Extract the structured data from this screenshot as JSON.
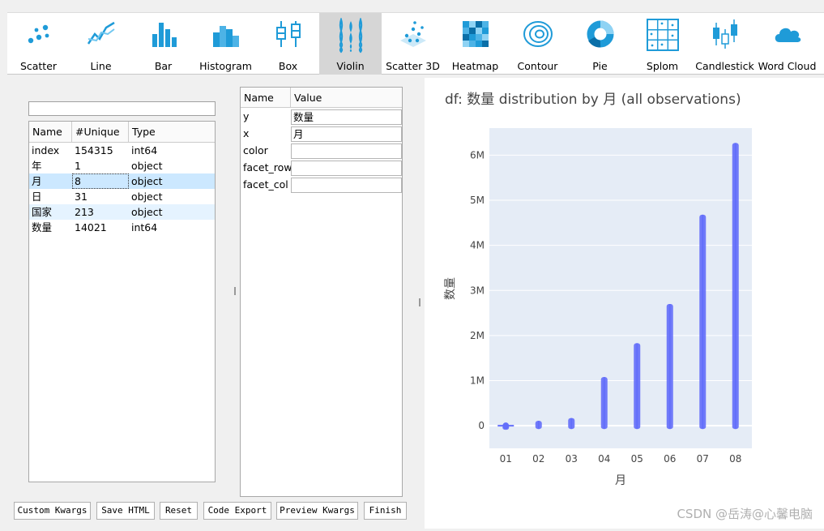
{
  "toolbar": {
    "items": [
      {
        "label": "Scatter",
        "icon": "scatter-icon"
      },
      {
        "label": "Line",
        "icon": "line-icon"
      },
      {
        "label": "Bar",
        "icon": "bar-icon"
      },
      {
        "label": "Histogram",
        "icon": "histogram-icon"
      },
      {
        "label": "Box",
        "icon": "box-icon"
      },
      {
        "label": "Violin",
        "icon": "violin-icon",
        "active": true
      },
      {
        "label": "Scatter 3D",
        "icon": "scatter3d-icon"
      },
      {
        "label": "Heatmap",
        "icon": "heatmap-icon"
      },
      {
        "label": "Contour",
        "icon": "contour-icon"
      },
      {
        "label": "Pie",
        "icon": "pie-icon"
      },
      {
        "label": "Splom",
        "icon": "splom-icon"
      },
      {
        "label": "Candlestick",
        "icon": "candlestick-icon"
      },
      {
        "label": "Word Cloud",
        "icon": "cloud-icon"
      }
    ]
  },
  "columns": {
    "filter_value": "",
    "headers": [
      "Name",
      "#Unique",
      "Type"
    ],
    "rows": [
      {
        "name": "index",
        "unique": "154315",
        "type": "int64"
      },
      {
        "name": "年",
        "unique": "1",
        "type": "object"
      },
      {
        "name": "月",
        "unique": "8",
        "type": "object",
        "selected": true
      },
      {
        "name": "日",
        "unique": "31",
        "type": "object"
      },
      {
        "name": "国家",
        "unique": "213",
        "type": "object",
        "hover": true
      },
      {
        "name": "数量",
        "unique": "14021",
        "type": "int64"
      }
    ]
  },
  "kwargs": {
    "headers": [
      "Name",
      "Value"
    ],
    "rows": [
      {
        "name": "y",
        "value": "数量"
      },
      {
        "name": "x",
        "value": "月"
      },
      {
        "name": "color",
        "value": ""
      },
      {
        "name": "facet_row",
        "value": ""
      },
      {
        "name": "facet_col",
        "value": ""
      }
    ]
  },
  "buttons": {
    "custom_kwargs": "Custom Kwargs",
    "save_html": "Save HTML",
    "reset": "Reset",
    "code_export": "Code Export",
    "preview_kwargs": "Preview Kwargs",
    "finish": "Finish"
  },
  "colors": {
    "accent": "#1f9bd8",
    "violin": "#636efa",
    "plot_bg": "#e5ecf6",
    "selection": "#cce8ff"
  },
  "chart_data": {
    "type": "violin",
    "title": "df: 数量 distribution by 月 (all observations)",
    "xlabel": "月",
    "ylabel": "数量",
    "categories": [
      "01",
      "02",
      "03",
      "04",
      "05",
      "06",
      "07",
      "08"
    ],
    "ylim": [
      -500000,
      6600000
    ],
    "yticks": [
      0,
      1000000,
      2000000,
      3000000,
      4000000,
      5000000,
      6000000
    ],
    "ytick_labels": [
      "0",
      "1M",
      "2M",
      "3M",
      "4M",
      "5M",
      "6M"
    ],
    "series": [
      {
        "points": "all",
        "values_min": [
          0,
          0,
          0,
          0,
          0,
          0,
          0,
          0
        ],
        "values_max": [
          20000,
          110000,
          170000,
          1080000,
          1830000,
          2700000,
          4680000,
          6270000
        ]
      }
    ]
  },
  "watermark": "CSDN @岳涛@心馨电脑"
}
